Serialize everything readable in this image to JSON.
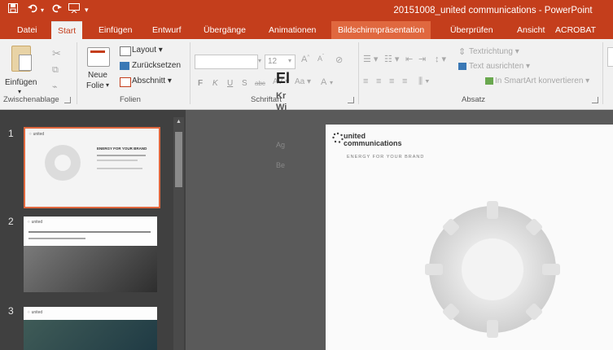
{
  "quick_access": {
    "save_icon": "save-icon",
    "undo_icon": "undo-icon",
    "redo_icon": "redo-icon",
    "customize_icon": "customize-icon"
  },
  "title": "20151008_united communications - PowerPoint",
  "tabs": [
    {
      "label": "Datei"
    },
    {
      "label": "Start"
    },
    {
      "label": "Einfügen"
    },
    {
      "label": "Entwurf"
    },
    {
      "label": "Übergänge"
    },
    {
      "label": "Animationen"
    },
    {
      "label": "Bildschirmpräsentation"
    },
    {
      "label": "Überprüfen"
    },
    {
      "label": "Ansicht"
    },
    {
      "label": "ACROBAT"
    }
  ],
  "ribbon": {
    "clipboard": {
      "paste": "Einfügen",
      "group": "Zwischenablage"
    },
    "slides": {
      "new_slide_1": "Neue",
      "new_slide_2": "Folie",
      "layout": "Layout",
      "reset": "Zurücksetzen",
      "section": "Abschnitt",
      "group": "Folien"
    },
    "font": {
      "size": "12",
      "font_color": "A",
      "bold": "F",
      "italic": "K",
      "underline": "U",
      "strike": "S",
      "spacing": "abc",
      "group": "Schriftart"
    },
    "paragraph": {
      "text_direction": "Textrichtung",
      "align_text": "Text ausrichten",
      "smartart": "In SmartArt konvertieren",
      "group": "Absatz"
    }
  },
  "thumbnails": [
    {
      "number": "1",
      "title": "ENERGY FOR YOUR BRAND"
    },
    {
      "number": "2"
    },
    {
      "number": "3"
    }
  ],
  "slide": {
    "brand_line1": "united",
    "brand_line2": "communications",
    "tagline": "ENERGY FOR YOUR BRAND",
    "heading": "El",
    "subheading_1": "Kr",
    "subheading_2": "Wi",
    "text_1": "Ag",
    "text_2": "Be"
  },
  "colors": {
    "accent": "#c43e1c",
    "tab_hover": "#e0683f",
    "ribbon": "#f1f1f1",
    "thumb_selected": "#e0683f"
  }
}
